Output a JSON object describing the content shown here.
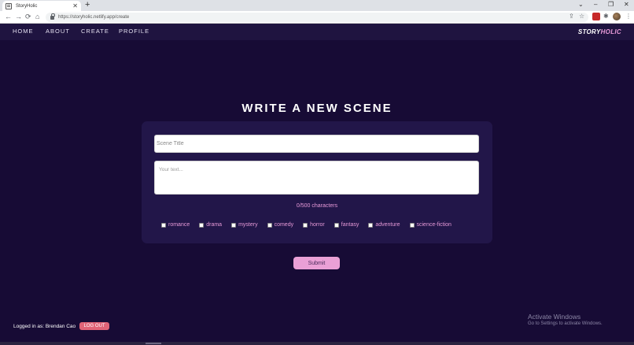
{
  "browser": {
    "tab_title": "StoryHolic",
    "tab_close": "✕",
    "new_tab": "+",
    "url": "https://storyholic.netlify.app/create",
    "back": "←",
    "forward": "→",
    "reload": "⟳",
    "home": "⌂",
    "minimize": "–",
    "restore": "❐",
    "close": "✕",
    "tab_dropdown": "⌄",
    "share": "⇪",
    "star": "☆",
    "puzzle": "✱",
    "menu": "⋮"
  },
  "nav": {
    "items": [
      {
        "label": "HOME"
      },
      {
        "label": "ABOUT"
      },
      {
        "label": "CREATE"
      },
      {
        "label": "PROFILE"
      }
    ],
    "logo_part1": "STORY",
    "logo_part2": "HOLIC"
  },
  "main": {
    "heading": "WRITE A NEW SCENE",
    "title_placeholder": "Scene Title",
    "text_placeholder": "Your text...",
    "char_count": "0/500 characters",
    "genres": [
      {
        "label": "romance"
      },
      {
        "label": "drama"
      },
      {
        "label": "mystery"
      },
      {
        "label": "comedy"
      },
      {
        "label": "horror"
      },
      {
        "label": "fantasy"
      },
      {
        "label": "adventure"
      },
      {
        "label": "science-fiction"
      }
    ],
    "submit_label": "Submit"
  },
  "footer": {
    "logged_in_text": "Logged in as: Brendan Cao",
    "logout_label": "LOG OUT"
  },
  "windows_watermark": {
    "title": "Activate Windows",
    "subtitle": "Go to Settings to activate Windows."
  },
  "colors": {
    "background": "#170b35",
    "card": "#221649",
    "accent_pink": "#e79ad8",
    "submit_bg": "#eaa0d6",
    "logout_bg": "#e06377"
  }
}
